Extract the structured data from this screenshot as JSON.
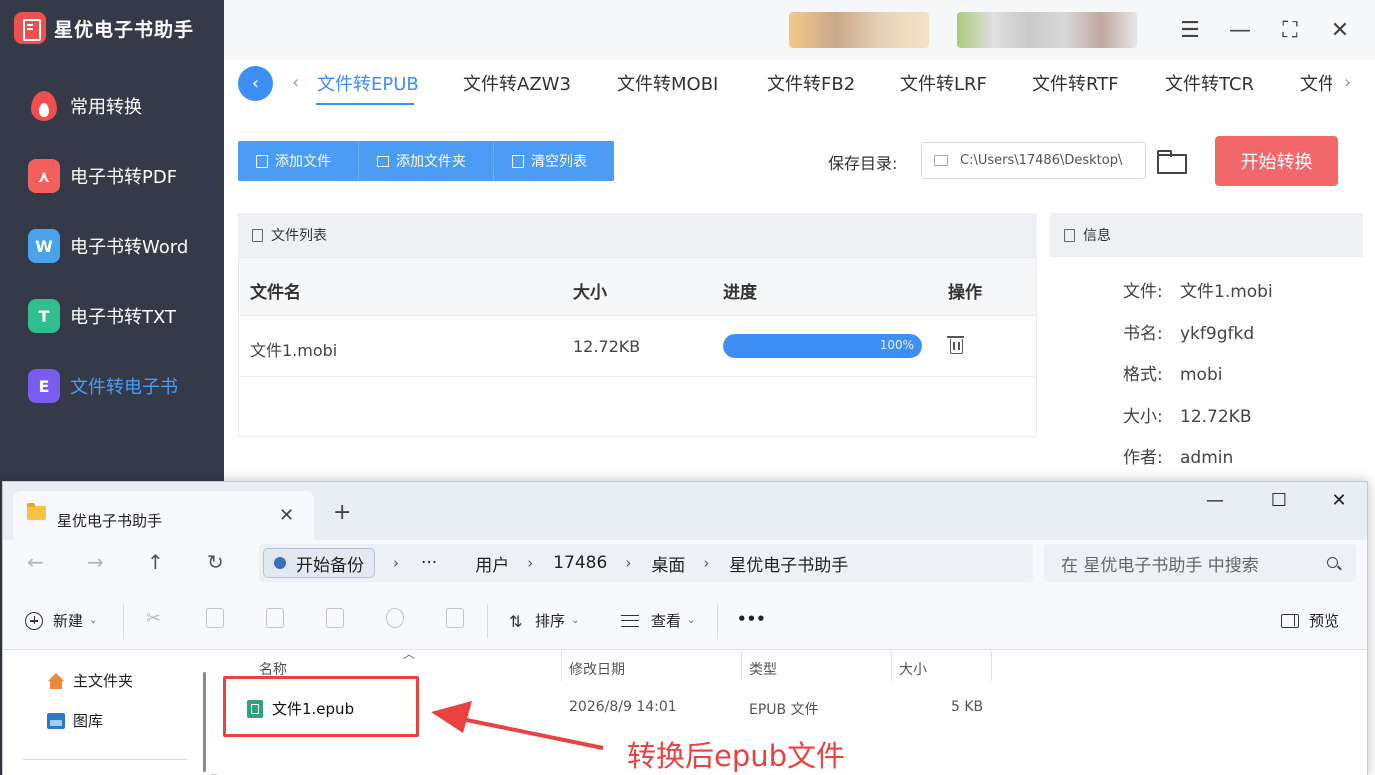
{
  "app": {
    "title": "星优电子书助手",
    "sidebar": [
      {
        "label": "常用转换",
        "icon": "flame-icon",
        "color": "#f04f4f"
      },
      {
        "label": "电子书转PDF",
        "icon": "pdf-icon",
        "color": "#f25f5c"
      },
      {
        "label": "电子书转Word",
        "icon": "word-icon",
        "color": "#4aa3e8"
      },
      {
        "label": "电子书转TXT",
        "icon": "txt-icon",
        "color": "#2fbf8f"
      },
      {
        "label": "文件转电子书",
        "icon": "ebook-icon",
        "color": "#7b5cf0",
        "active": true
      }
    ],
    "tabs": [
      "文件转EPUB",
      "文件转AZW3",
      "文件转MOBI",
      "文件转FB2",
      "文件转LRF",
      "文件转RTF",
      "文件转TCR",
      "文件"
    ],
    "active_tab": "文件转EPUB",
    "toolbar": {
      "add_file": "添加文件",
      "add_folder": "添加文件夹",
      "clear_list": "清空列表",
      "save_label": "保存目录:",
      "save_path": "C:\\Users\\17486\\Desktop\\",
      "start": "开始转换"
    },
    "file_list": {
      "title": "文件列表",
      "headers": {
        "name": "文件名",
        "size": "大小",
        "progress": "进度",
        "action": "操作"
      },
      "rows": [
        {
          "name": "文件1.mobi",
          "size": "12.72KB",
          "progress": 100,
          "progress_text": "100%"
        }
      ]
    },
    "info": {
      "title": "信息",
      "rows": [
        {
          "key": "文件:",
          "value": "文件1.mobi"
        },
        {
          "key": "书名:",
          "value": "ykf9gfkd"
        },
        {
          "key": "格式:",
          "value": "mobi"
        },
        {
          "key": "大小:",
          "value": "12.72KB"
        },
        {
          "key": "作者:",
          "value": "admin"
        }
      ]
    }
  },
  "explorer": {
    "tab_title": "星优电子书助手",
    "address": {
      "chip": "开始备份",
      "crumbs": [
        "用户",
        "17486",
        "桌面",
        "星优电子书助手"
      ]
    },
    "search_placeholder": "在 星优电子书助手 中搜索",
    "commands": {
      "new": "新建",
      "sort": "排序",
      "view": "查看",
      "more": "•••",
      "preview": "预览"
    },
    "nav": [
      {
        "label": "主文件夹",
        "icon": "home-icon"
      },
      {
        "label": "图库",
        "icon": "gallery-icon"
      }
    ],
    "columns": {
      "name": "名称",
      "modified": "修改日期",
      "type": "类型",
      "size": "大小"
    },
    "files": [
      {
        "name": "文件1.epub",
        "modified": "2026/8/9 14:01",
        "type": "EPUB 文件",
        "size": "5 KB"
      }
    ]
  },
  "annotation": {
    "text": "转换后epub文件",
    "color": "#e9423f"
  }
}
